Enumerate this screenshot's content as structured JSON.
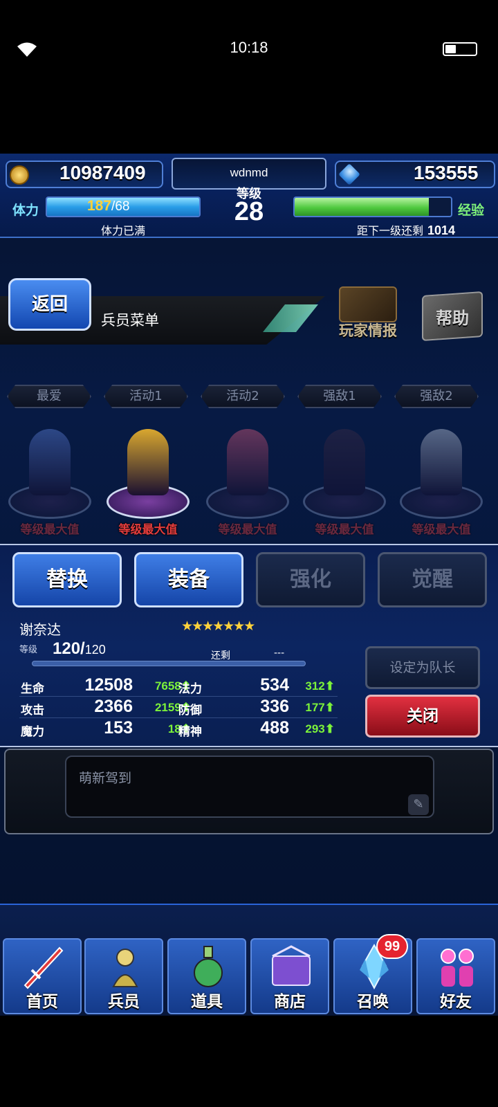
{
  "status": {
    "time": "10:18",
    "battery_level": 0.35
  },
  "top": {
    "gold": "10987409",
    "gems": "153555",
    "player_name": "wdnmd",
    "level_label": "等级",
    "level": "28",
    "stamina_label": "体力",
    "stamina_current": "187",
    "stamina_max": "/68",
    "stamina_fill": 1.0,
    "stamina_note": "体力已满",
    "exp_label": "经验",
    "exp_fill": 0.86,
    "exp_note": "距下一级还剩",
    "exp_remaining": "1014"
  },
  "header": {
    "back_label": "返回",
    "title": "兵员菜单",
    "player_info_label": "玩家情报",
    "help_label": "帮助"
  },
  "party_tabs": [
    "最爱",
    "活动1",
    "活动2",
    "强敌1",
    "强敌2"
  ],
  "units": [
    {
      "label": "等级最大值",
      "color": "#5a7fd8",
      "selected": false
    },
    {
      "label": "等级最大值",
      "color": "#d9a72f",
      "selected": true
    },
    {
      "label": "等级最大值",
      "color": "#d4587a",
      "selected": false
    },
    {
      "label": "等级最大值",
      "color": "#3a2b45",
      "selected": false
    },
    {
      "label": "等级最大值",
      "color": "#b8c4d8",
      "selected": false
    }
  ],
  "actions": {
    "replace": "替换",
    "equip": "装备",
    "enhance": "强化",
    "awaken": "觉醒"
  },
  "unit_detail": {
    "name": "谢奈达",
    "stars": "★★★★★★★",
    "level_label": "等级",
    "level": "120/",
    "level_max": "120",
    "remaining_label": "还剩",
    "remaining_value": "---",
    "stats": [
      {
        "l1": "生命",
        "v1": "12508",
        "b1": "7658⬆",
        "l2": "法力",
        "v2": "534",
        "b2": "312⬆"
      },
      {
        "l1": "攻击",
        "v1": "2366",
        "b1": "2159⬆",
        "l2": "防御",
        "v2": "336",
        "b2": "177⬆"
      },
      {
        "l1": "魔力",
        "v1": "153",
        "b1": "18⬆",
        "l2": "精神",
        "v2": "488",
        "b2": "293⬆"
      }
    ],
    "set_leader_label": "设定为队长",
    "close_label": "关闭"
  },
  "message": {
    "placeholder": "萌新驾到"
  },
  "nav": {
    "home": "首页",
    "units": "兵员",
    "items": "道具",
    "shop": "商店",
    "summon": "召唤",
    "friends": "好友",
    "summon_badge": "99"
  }
}
